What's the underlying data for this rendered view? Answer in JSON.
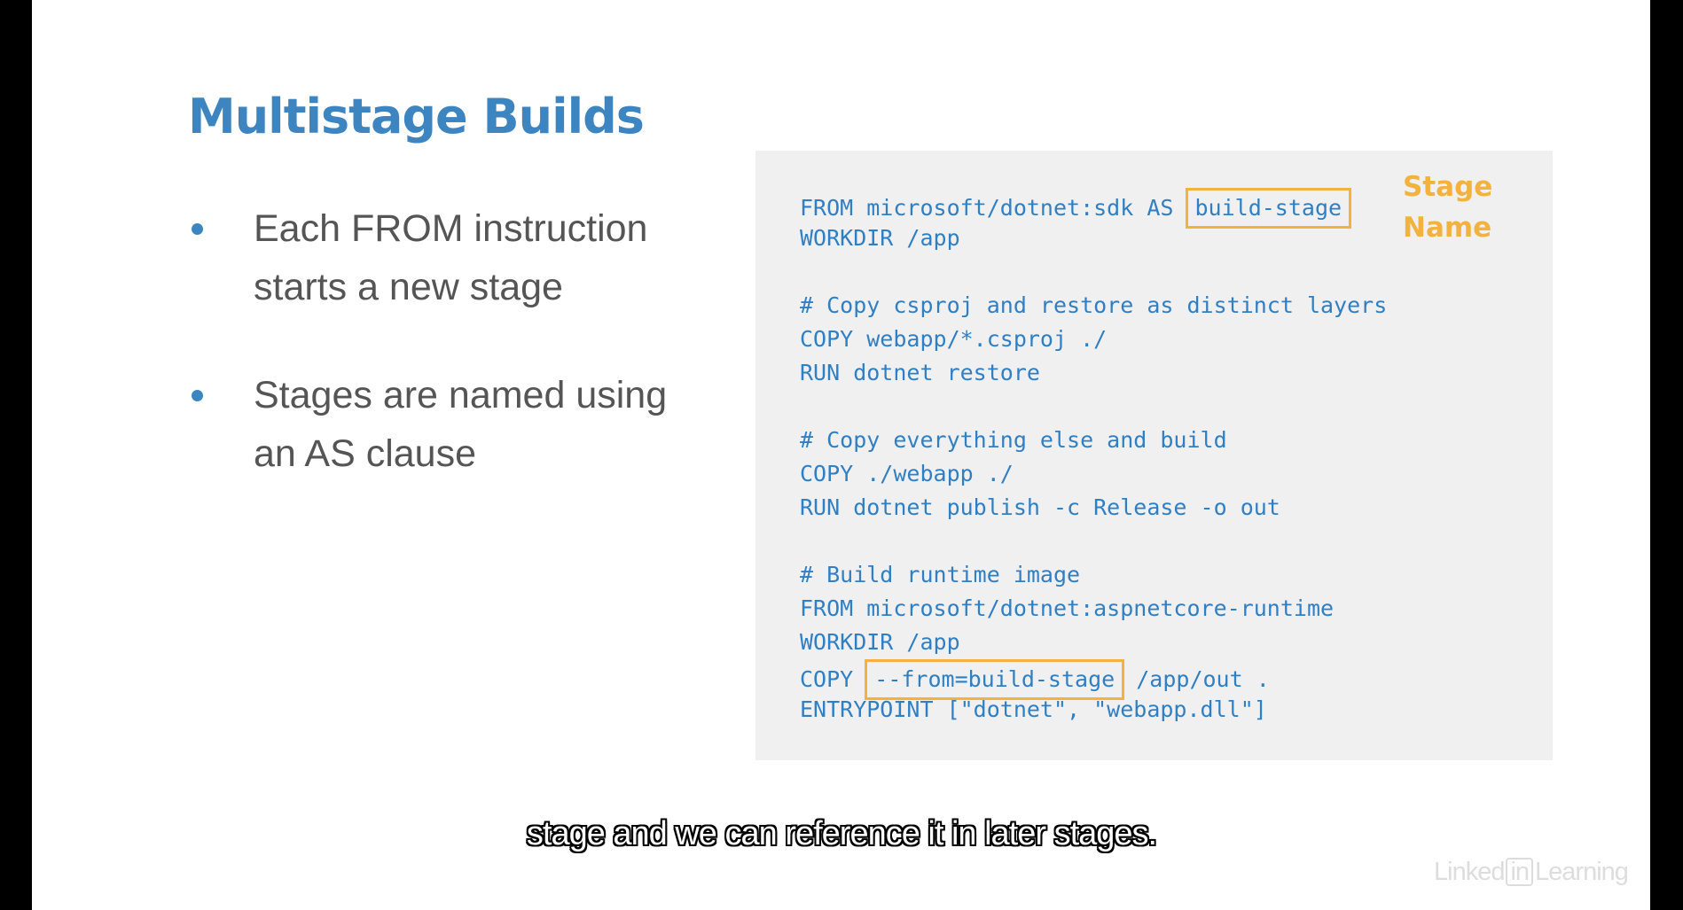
{
  "slide": {
    "title": "Multistage Builds",
    "bullets": [
      {
        "line1": "Each FROM instruction",
        "line2": "starts a new stage"
      },
      {
        "line1": "Stages are named using",
        "line2": "an AS clause"
      }
    ]
  },
  "code": {
    "line1_pre": "FROM microsoft/dotnet:sdk AS ",
    "line1_highlight": "build-stage",
    "line2": "WORKDIR /app",
    "line3": "# Copy csproj and restore as distinct layers",
    "line4": "COPY webapp/*.csproj ./",
    "line5": "RUN dotnet restore",
    "line6": "# Copy everything else and build",
    "line7": "COPY ./webapp ./",
    "line8": "RUN dotnet publish -c Release -o out",
    "line9": "# Build runtime image",
    "line10": "FROM microsoft/dotnet:aspnetcore-runtime",
    "line11": "WORKDIR /app",
    "line12_pre": "COPY ",
    "line12_highlight": "--from=build-stage",
    "line12_post": " /app/out .",
    "line13": "ENTRYPOINT [\"dotnet\", \"webapp.dll\"]"
  },
  "annotation": {
    "line1": "Stage",
    "line2": "Name"
  },
  "caption": "stage and we can reference it in later stages.",
  "watermark": {
    "left": "Linked",
    "in": "in",
    "right": "Learning"
  },
  "colors": {
    "title_blue": "#3d85c0",
    "code_blue": "#2f7fc4",
    "highlight_orange": "#f3b13d",
    "bullet_text": "#555555",
    "code_background": "#f0f0f0"
  }
}
